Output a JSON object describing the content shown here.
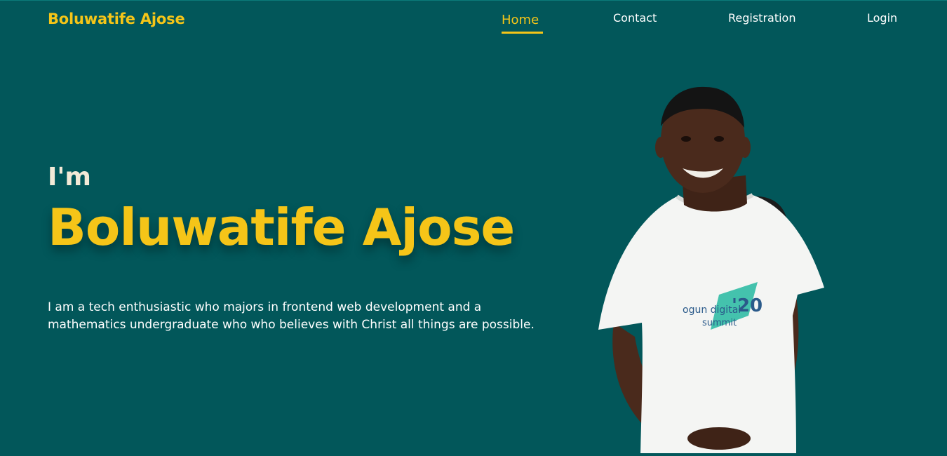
{
  "header": {
    "brand": "Boluwatife Ajose",
    "nav": [
      {
        "label": "Home",
        "active": true
      },
      {
        "label": "Contact"
      },
      {
        "label": "Registration"
      },
      {
        "label": "Login"
      }
    ]
  },
  "hero": {
    "greeting": "I'm",
    "name": "Boluwatife Ajose",
    "bio": "I am a tech enthusiastic who majors in frontend web development and a mathematics undergraduate who who believes with Christ all things are possible."
  },
  "photo": {
    "shirt_text": [
      "ogun digital",
      "summit"
    ],
    "shirt_number": "'20"
  },
  "colors": {
    "background": "#02575a",
    "accent": "#f5c518",
    "text": "#ffffff"
  }
}
